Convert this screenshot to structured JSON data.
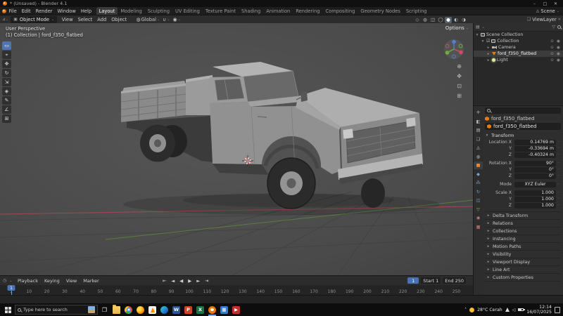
{
  "titlebar": {
    "title": "* (Unsaved) - Blender 4.1",
    "minimize": "–",
    "maximize": "□",
    "close": "✕"
  },
  "topbar": {
    "menus": [
      "File",
      "Edit",
      "Render",
      "Window",
      "Help"
    ],
    "workspaces": [
      "Layout",
      "Modeling",
      "Sculpting",
      "UV Editing",
      "Texture Paint",
      "Shading",
      "Animation",
      "Rendering",
      "Compositing",
      "Geometry Nodes",
      "Scripting"
    ],
    "active_workspace": "Layout",
    "scene_label": "Scene",
    "view_layer_label": "ViewLayer"
  },
  "viewport_header": {
    "mode_label": "Object Mode",
    "menus": [
      "View",
      "Select",
      "Add",
      "Object"
    ],
    "orientation_label": "Global",
    "mid_icons": [
      {
        "name": "snap-magnet-icon",
        "glyph": "∪"
      },
      {
        "name": "proportional-editing-icon",
        "glyph": "◉"
      }
    ],
    "shading_icons": [
      {
        "name": "show-gizmo-icon",
        "glyph": "◇"
      },
      {
        "name": "show-overlays-icon",
        "glyph": "◍"
      },
      {
        "name": "toggle-xray-icon",
        "glyph": "◫"
      },
      {
        "name": "shading-wireframe-icon",
        "glyph": "◯"
      },
      {
        "name": "shading-solid-icon",
        "glyph": "●",
        "active": true
      },
      {
        "name": "shading-material-preview-icon",
        "glyph": "◐"
      },
      {
        "name": "shading-rendered-icon",
        "glyph": "◑"
      }
    ]
  },
  "viewport": {
    "perspective_label": "User Perspective",
    "collection_label": "(1) Collection | ford_f350_flatbed",
    "options_label": "Options",
    "tools": [
      {
        "name": "tool-select-box",
        "glyph": "▭"
      },
      {
        "name": "tool-3d-cursor",
        "glyph": "⌖"
      },
      {
        "name": "tool-move",
        "glyph": "✥"
      },
      {
        "name": "tool-rotate",
        "glyph": "↻"
      },
      {
        "name": "tool-scale",
        "glyph": "⇲"
      },
      {
        "name": "tool-transform",
        "glyph": "◈"
      },
      {
        "name": "tool-annotate",
        "glyph": "✎"
      },
      {
        "name": "tool-measure",
        "glyph": "∠"
      },
      {
        "name": "tool-add-cube",
        "glyph": "⊞"
      }
    ],
    "nav_icons": [
      {
        "name": "zoom-icon",
        "glyph": "⊕"
      },
      {
        "name": "pan-hand-icon",
        "glyph": "✥"
      },
      {
        "name": "camera-view-icon",
        "glyph": "⊡"
      },
      {
        "name": "toggle-ortho-icon",
        "glyph": "⊞"
      }
    ],
    "axis_colors": {
      "x": "#d14b61",
      "y": "#6fae3e",
      "z": "#4e7fd0"
    }
  },
  "outliner": {
    "rows": [
      {
        "label": "Scene Collection",
        "depth": 0,
        "caret": "▾",
        "icon": "ico-scene"
      },
      {
        "label": "Collection",
        "depth": 1,
        "caret": "▾",
        "icon": "ico-collection",
        "checkbox": true,
        "toggles": true
      },
      {
        "label": "Camera",
        "depth": 2,
        "caret": "▸",
        "icon": "ico-camera",
        "toggles": true
      },
      {
        "label": "ford_f350_flatbed",
        "depth": 2,
        "caret": "▸",
        "icon": "ico-mesh",
        "selected": true,
        "toggles": true
      },
      {
        "label": "Light",
        "depth": 2,
        "caret": "▸",
        "icon": "ico-light",
        "toggles": true
      }
    ]
  },
  "properties": {
    "breadcrumb": "ford_f350_flatbed",
    "object_name": "ford_f350_flatbed",
    "transform_label": "Transform",
    "tabs": [
      {
        "name": "tab-tool",
        "glyph": "✛",
        "color": "#b9b9b9"
      },
      {
        "name": "tab-render",
        "glyph": "◧",
        "color": "#b9b9b9"
      },
      {
        "name": "tab-output",
        "glyph": "▤",
        "color": "#b9b9b9"
      },
      {
        "name": "tab-view-layer",
        "glyph": "❏",
        "color": "#b9b9b9"
      },
      {
        "name": "tab-scene",
        "glyph": "◬",
        "color": "#b9b9b9"
      },
      {
        "name": "tab-world",
        "glyph": "◍",
        "color": "#b9b9b9"
      },
      {
        "name": "tab-object",
        "glyph": "■",
        "color": "#e8883a",
        "active": true
      },
      {
        "name": "tab-modifiers",
        "glyph": "◆",
        "color": "#7aa5d8"
      },
      {
        "name": "tab-particles",
        "glyph": "⁂",
        "color": "#7aa5d8"
      },
      {
        "name": "tab-physics",
        "glyph": "↻",
        "color": "#7aa5d8"
      },
      {
        "name": "tab-constraints",
        "glyph": "◫",
        "color": "#7aa5d8"
      },
      {
        "name": "tab-object-data",
        "glyph": "▽",
        "color": "#8bc34a"
      },
      {
        "name": "tab-material",
        "glyph": "◉",
        "color": "#d07a7a"
      },
      {
        "name": "tab-texture",
        "glyph": "▦",
        "color": "#d07a7a"
      }
    ],
    "transform": {
      "rows": [
        {
          "label": "Location X",
          "value": "0.14769 m"
        },
        {
          "label": "Y",
          "value": "-0.33694 m"
        },
        {
          "label": "Z",
          "value": "-0.40324 m"
        },
        {
          "label": "Rotation X",
          "value": "90°",
          "gap": true
        },
        {
          "label": "Y",
          "value": "0°"
        },
        {
          "label": "Z",
          "value": "0°"
        },
        {
          "label": "Mode",
          "value": "XYZ Euler",
          "gap": true,
          "enum": true
        },
        {
          "label": "Scale X",
          "value": "1.000",
          "gap": true
        },
        {
          "label": "Y",
          "value": "1.000"
        },
        {
          "label": "Z",
          "value": "1.000"
        }
      ]
    },
    "sections": [
      "Delta Transform",
      "Relations",
      "Collections",
      "Instancing",
      "Motion Paths",
      "Visibility",
      "Viewport Display",
      "Line Art",
      "Custom Properties"
    ]
  },
  "timeline": {
    "menus": [
      "Playback",
      "Keying",
      "View",
      "Marker"
    ],
    "transport": [
      {
        "name": "jump-to-start-button",
        "glyph": "⇤"
      },
      {
        "name": "prev-keyframe-button",
        "glyph": "◄"
      },
      {
        "name": "play-reverse-button",
        "glyph": "◀"
      },
      {
        "name": "play-button",
        "glyph": "▶"
      },
      {
        "name": "next-keyframe-button",
        "glyph": "►"
      },
      {
        "name": "jump-to-end-button",
        "glyph": "⇥"
      }
    ],
    "current_frame": "1",
    "start_label": "Start",
    "start_value": "1",
    "end_label": "End",
    "end_value": "250",
    "ticks": [
      "1",
      "10",
      "20",
      "30",
      "40",
      "50",
      "60",
      "70",
      "80",
      "90",
      "100",
      "110",
      "120",
      "130",
      "140",
      "150",
      "160",
      "170",
      "180",
      "190",
      "200",
      "210",
      "220",
      "230",
      "240",
      "250"
    ]
  },
  "taskbar": {
    "search_placeholder": "Type here to search",
    "apps": [
      {
        "name": "task-view-icon",
        "css": "taskview",
        "glyph": "❐"
      },
      {
        "name": "file-explorer-icon",
        "css": "folder"
      },
      {
        "name": "chrome-icon",
        "css": "chrome"
      },
      {
        "name": "firefox-icon",
        "css": "firefox"
      },
      {
        "name": "vlc-icon",
        "css": "vlc"
      },
      {
        "name": "edge-icon",
        "css": "edge"
      },
      {
        "name": "word-icon",
        "color": "#2a5699",
        "glyph": "W"
      },
      {
        "name": "powerpoint-icon",
        "color": "#d04424",
        "glyph": "P"
      },
      {
        "name": "excel-icon",
        "color": "#1e7145",
        "glyph": "X"
      },
      {
        "name": "blender-icon",
        "css": "blender",
        "running": true
      },
      {
        "name": "photos-icon",
        "color": "#2f7cd6",
        "glyph": "▦"
      },
      {
        "name": "media-player-icon",
        "color": "#c4302b",
        "glyph": "▶"
      }
    ],
    "tray": {
      "expand": "˄",
      "weather": "28°C Cerah",
      "time": "12:14",
      "date": "16/07/2025"
    }
  },
  "accent_colors": {
    "blender_orange": "#e87d0d",
    "frame_blue": "#4772b3"
  }
}
